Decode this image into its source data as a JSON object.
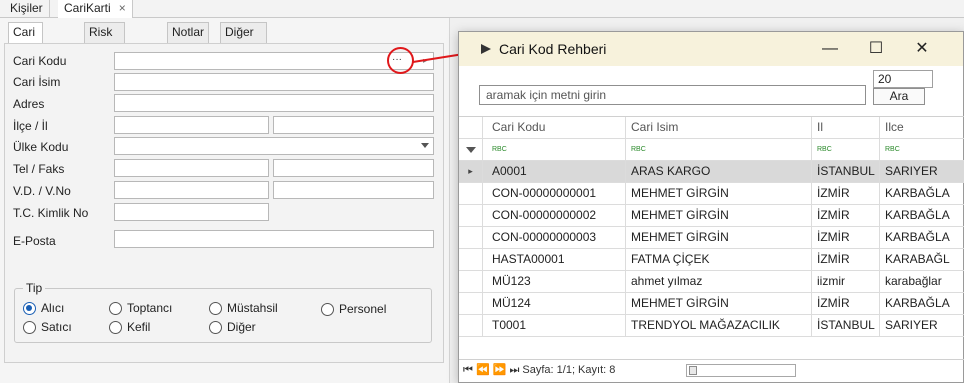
{
  "doc_tabs": [
    {
      "label": "Kişiler"
    },
    {
      "label": "CariKarti",
      "close": "×"
    }
  ],
  "inner_tabs": [
    "Cari Kartı",
    "Risk Takibi",
    "Notlar",
    "Diğer İletişim"
  ],
  "form": {
    "labels": {
      "cari_kodu": "Cari Kodu",
      "cari_isim": "Cari İsim",
      "adres": "Adres",
      "ilce_il": "İlçe / İl",
      "ulke_kodu": "Ülke Kodu",
      "tel_faks": "Tel / Faks",
      "vd_vno": "V.D. / V.No",
      "tc_kimlik": "T.C. Kimlik No",
      "eposta": "E-Posta"
    },
    "ellipsis": "···",
    "tip": {
      "legend": "Tip",
      "options": [
        "Alıcı",
        "Toptancı",
        "Müstahsil",
        "Personel",
        "Satıcı",
        "Kefil",
        "Diğer"
      ],
      "selected": "Alıcı"
    }
  },
  "dialog": {
    "title": "Cari Kod Rehberi",
    "minimize": "—",
    "maximize": "☐",
    "close": "✕",
    "search_placeholder": "aramak için metni girin",
    "page_size": "20",
    "search_button": "Ara",
    "columns": [
      "Cari Kodu",
      "Cari Isim",
      "Il",
      "Ilce"
    ],
    "filter_chip": "RBC",
    "rows": [
      [
        "A0001",
        "ARAS KARGO",
        "İSTANBUL",
        "SARIYER"
      ],
      [
        "CON-00000000001",
        "MEHMET GİRGİN",
        "İZMİR",
        "KARBAĞLA"
      ],
      [
        "CON-00000000002",
        "MEHMET GİRGİN",
        "İZMİR",
        "KARBAĞLA"
      ],
      [
        "CON-00000000003",
        "MEHMET GİRGİN",
        "İZMİR",
        "KARBAĞLA"
      ],
      [
        "HASTA00001",
        "FATMA ÇİÇEK",
        "İZMİR",
        "KARABAĞL"
      ],
      [
        "MÜ123",
        "ahmet yılmaz",
        "iizmir",
        "karabağlar"
      ],
      [
        "MÜ124",
        "MEHMET GİRGİN",
        "İZMİR",
        "KARBAĞLA"
      ],
      [
        "T0001",
        "TRENDYOL MAĞAZACILIK",
        "İSTANBUL",
        "SARIYER"
      ]
    ],
    "selected_row": 0,
    "pager_text": "⏮ ⏪ ⏩ ⏭ Sayfa: 1/1; Kayıt: 8",
    "colors": {
      "title_bg": "#f7f2dc",
      "accent_red": "#e0181b",
      "radio_blue": "#1a5fb4"
    }
  }
}
